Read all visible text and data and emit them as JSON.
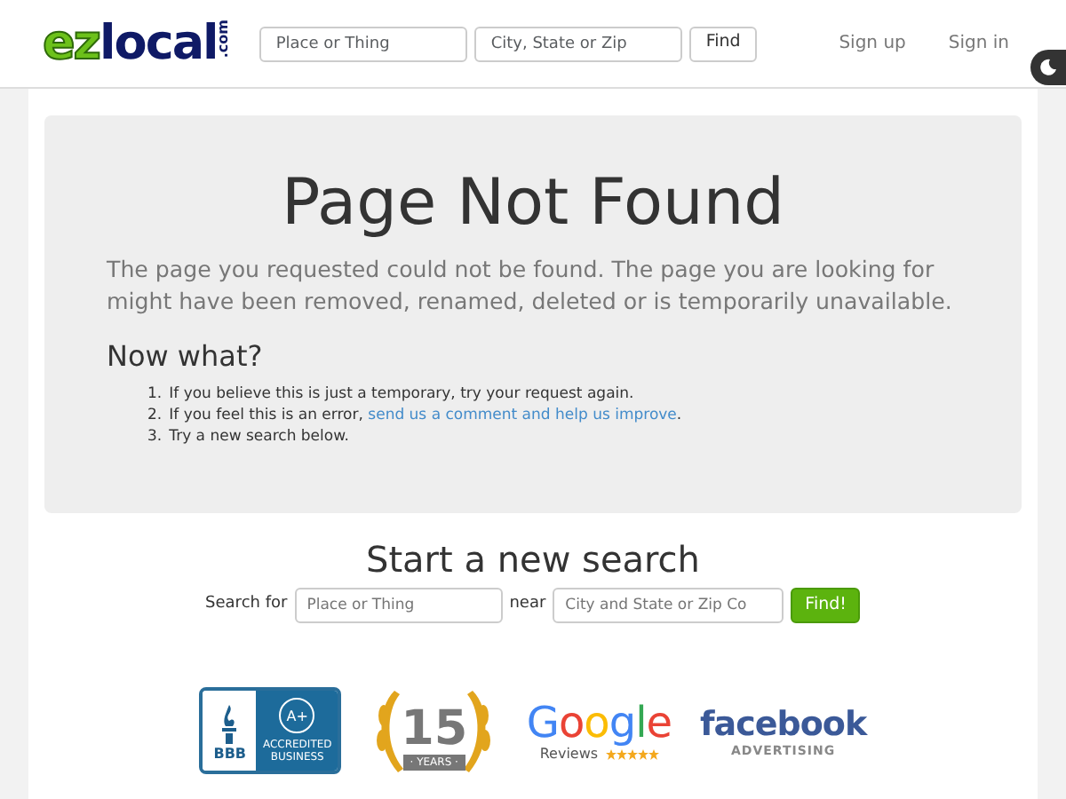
{
  "header": {
    "logo": {
      "main": "ezlocal",
      "dot_com": ".com"
    },
    "search": [
      {
        "placeholder": "Place or Thing"
      },
      {
        "placeholder": "City, State or Zip"
      }
    ],
    "find_button": "Find",
    "links": [
      "Sign up",
      "Sign in"
    ]
  },
  "theme_toggle": {
    "dark": true
  },
  "error_panel": {
    "title": "Page Not Found",
    "message": "The page you requested could not be found. The page you are looking for might have been removed, renamed, deleted or is temporarily unavailable.",
    "subtitle": "Now what?",
    "steps": [
      {
        "number": "1.",
        "text": "If you believe this is just a temporary, try your request again."
      },
      {
        "number": "2.",
        "text": "If you feel this is an error, ",
        "link": "send us a comment and help us improve",
        "after": "."
      },
      {
        "number": "3.",
        "text": "Try a new search below."
      }
    ]
  },
  "new_search": {
    "title": "Start a new search",
    "label_for": "Search for",
    "for_placeholder": "Place or Thing",
    "label_near": "near",
    "near_placeholder": "City and State or Zip Co",
    "button": "Find!"
  },
  "badges": [
    {
      "kind": "bbb",
      "texts": [
        "BBB",
        "A+",
        "ACCREDITED",
        "BUSINESS"
      ]
    },
    {
      "kind": "years",
      "texts": [
        "15",
        "· YEARS ·"
      ]
    },
    {
      "kind": "google",
      "texts": [
        "Google",
        "Reviews"
      ]
    },
    {
      "kind": "facebook",
      "texts": [
        "facebook",
        "ADVERTISING"
      ]
    }
  ]
}
